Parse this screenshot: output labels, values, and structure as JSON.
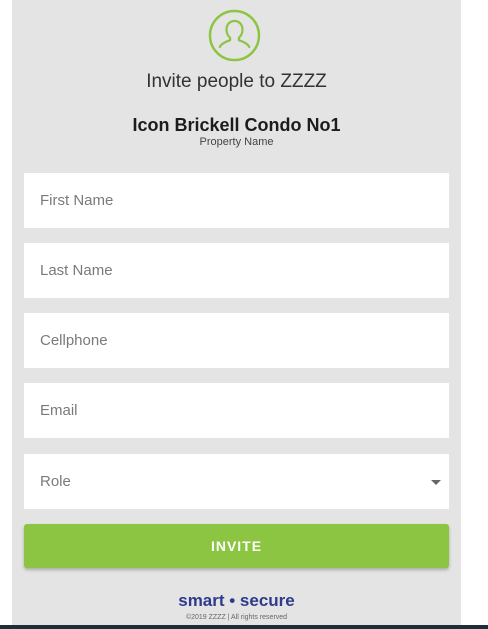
{
  "header": {
    "title": "Invite people to ZZZZ",
    "property_name": "Icon Brickell Condo No1",
    "property_caption": "Property Name"
  },
  "form": {
    "first_name_placeholder": "First Name",
    "last_name_placeholder": "Last Name",
    "cellphone_placeholder": "Cellphone",
    "email_placeholder": "Email",
    "role_label": "Role",
    "invite_label": "INVITE"
  },
  "footer": {
    "tagline": "smart • secure",
    "copyright": "©2019 ZZZZ | All rights reserved"
  },
  "colors": {
    "accent": "#8bc541",
    "panel": "#e4e4e4",
    "tagline": "#2e3a8c"
  }
}
